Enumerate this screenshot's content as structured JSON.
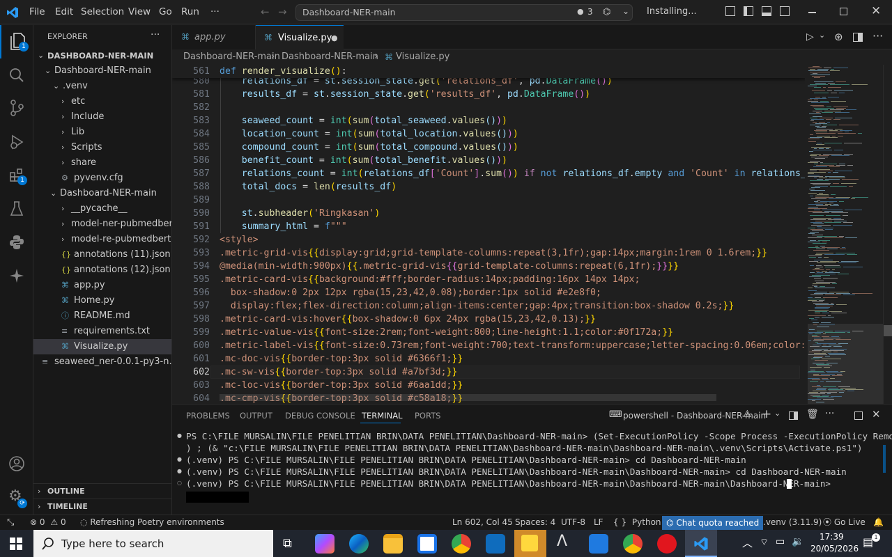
{
  "titlebar": {
    "menus": [
      "File",
      "Edit",
      "Selection",
      "View",
      "Go",
      "Run",
      "···"
    ],
    "search_text": "Dashboard-NER-main",
    "search_count": "3",
    "status": "Installing..."
  },
  "activity": {
    "explorer_badge": "1",
    "extensions_badge": "1"
  },
  "sidebar": {
    "header": "EXPLORER",
    "root": "DASHBOARD-NER-MAIN",
    "items": [
      {
        "label": "Dashboard-NER-main",
        "chev": "⌄",
        "icon": ""
      },
      {
        "label": ".venv",
        "chev": "⌄",
        "icon": ""
      },
      {
        "label": "etc",
        "chev": "›",
        "icon": ""
      },
      {
        "label": "Include",
        "chev": "›",
        "icon": ""
      },
      {
        "label": "Lib",
        "chev": "›",
        "icon": ""
      },
      {
        "label": "Scripts",
        "chev": "›",
        "icon": ""
      },
      {
        "label": "share",
        "chev": "›",
        "icon": ""
      },
      {
        "label": "pyvenv.cfg",
        "chev": "",
        "icon": "⚙"
      },
      {
        "label": "Dashboard-NER-main",
        "chev": "⌄",
        "icon": ""
      },
      {
        "label": "__pycache__",
        "chev": "›",
        "icon": ""
      },
      {
        "label": "model-ner-pubmedbert",
        "chev": "›",
        "icon": ""
      },
      {
        "label": "model-re-pubmedbert",
        "chev": "›",
        "icon": ""
      },
      {
        "label": "annotations (11).json",
        "chev": "",
        "icon": "{}"
      },
      {
        "label": "annotations (12).json",
        "chev": "",
        "icon": "{}"
      },
      {
        "label": "app.py",
        "chev": "",
        "icon": "py"
      },
      {
        "label": "Home.py",
        "chev": "",
        "icon": "py"
      },
      {
        "label": "README.md",
        "chev": "",
        "icon": "ⓘ"
      },
      {
        "label": "requirements.txt",
        "chev": "",
        "icon": "≡"
      },
      {
        "label": "Visualize.py",
        "chev": "",
        "icon": "py"
      },
      {
        "label": "seaweed_ner-0.0.1-py3-n...",
        "chev": "",
        "icon": "≡"
      }
    ],
    "outline": "OUTLINE",
    "timeline": "TIMELINE"
  },
  "tabs": [
    {
      "label": "app.py"
    },
    {
      "label": "Visualize.py"
    }
  ],
  "breadcrumb": [
    "Dashboard-NER-main",
    "Dashboard-NER-main",
    "Visualize.py"
  ],
  "editor": {
    "sticky_line": "561",
    "line_numbers": [
      "580",
      "581",
      "582",
      "583",
      "584",
      "585",
      "586",
      "587",
      "588",
      "589",
      "590",
      "591",
      "592",
      "593",
      "594",
      "595",
      "596",
      "597",
      "598",
      "599",
      "600",
      "601",
      "602",
      "603",
      "604"
    ]
  },
  "panel": {
    "tabs": [
      "PROBLEMS",
      "OUTPUT",
      "DEBUG CONSOLE",
      "TERMINAL",
      "PORTS"
    ],
    "active_tab": "TERMINAL",
    "shell": "powershell - Dashboard-NER-main",
    "terminal_lines": [
      "PS C:\\FILE MURSALIN\\FILE PENELITIAN BRIN\\DATA PENELITIAN\\Dashboard-NER-main> (Set-ExecutionPolicy -Scope Process -ExecutionPolicy RemoteSigned",
      ") ; (& \"c:\\FILE MURSALIN\\FILE PENELITIAN BRIN\\DATA PENELITIAN\\Dashboard-NER-main\\Dashboard-NER-main\\.venv\\Scripts\\Activate.ps1\")",
      "(.venv) PS C:\\FILE MURSALIN\\FILE PENELITIAN BRIN\\DATA PENELITIAN\\Dashboard-NER-main> cd Dashboard-NER-main",
      "(.venv) PS C:\\FILE MURSALIN\\FILE PENELITIAN BRIN\\DATA PENELITIAN\\Dashboard-NER-main\\Dashboard-NER-main> cd Dashboard-NER-main",
      "(.venv) PS C:\\FILE MURSALIN\\FILE PENELITIAN BRIN\\DATA PENELITIAN\\Dashboard-NER-main\\Dashboard-NER-main\\Dashboard-NER-main> "
    ]
  },
  "statusbar": {
    "errors": "0",
    "warnings": "0",
    "task": "Refreshing Poetry environments",
    "position": "Ln 602, Col 45",
    "spaces": "Spaces: 4",
    "encoding": "UTF-8",
    "eol": "LF",
    "language": "Python",
    "chat": "Chat quota reached",
    "interpreter": ".venv (3.11.9)",
    "golive": "Go Live"
  },
  "taskbar": {
    "search_placeholder": "Type here to search",
    "time": "17:39",
    "date": "20/05/2026"
  },
  "colors": {
    "accent": "#0078d4",
    "chat_badge": "#2b6cb0",
    "editor_bg": "#1f1f1f"
  }
}
